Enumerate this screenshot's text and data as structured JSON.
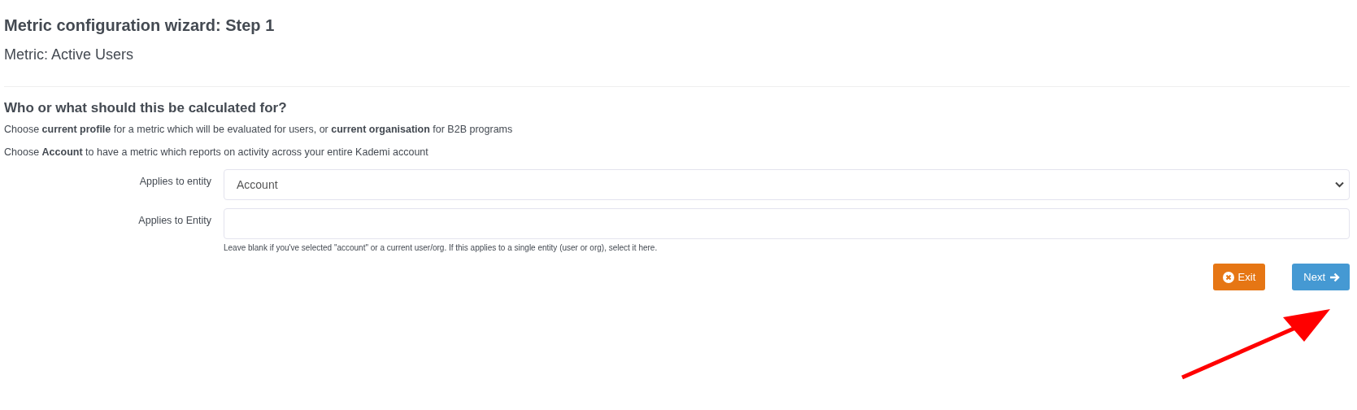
{
  "title": "Metric configuration wizard: Step 1",
  "subtitle": "Metric: Active Users",
  "section": {
    "heading": "Who or what should this be calculated for?",
    "paragraphs": [
      "Choose **current profile** for a metric which will be evaluated for users, or **current organisation** for B2B programs",
      "Choose **Account** to have a metric which reports on activity across your entire Kademi account"
    ]
  },
  "fields": [
    {
      "kind": "select",
      "label": "Applies to entity",
      "value": "Account"
    },
    {
      "kind": "text",
      "label": "Applies to Entity",
      "help": "Leave blank if you've selected \"account\" or a current user/org. If this applies to a single entity (user or org), select it here."
    }
  ],
  "buttons": [
    {
      "kind": "exit",
      "label": "Exit"
    },
    {
      "kind": "next",
      "label": "Next"
    }
  ]
}
